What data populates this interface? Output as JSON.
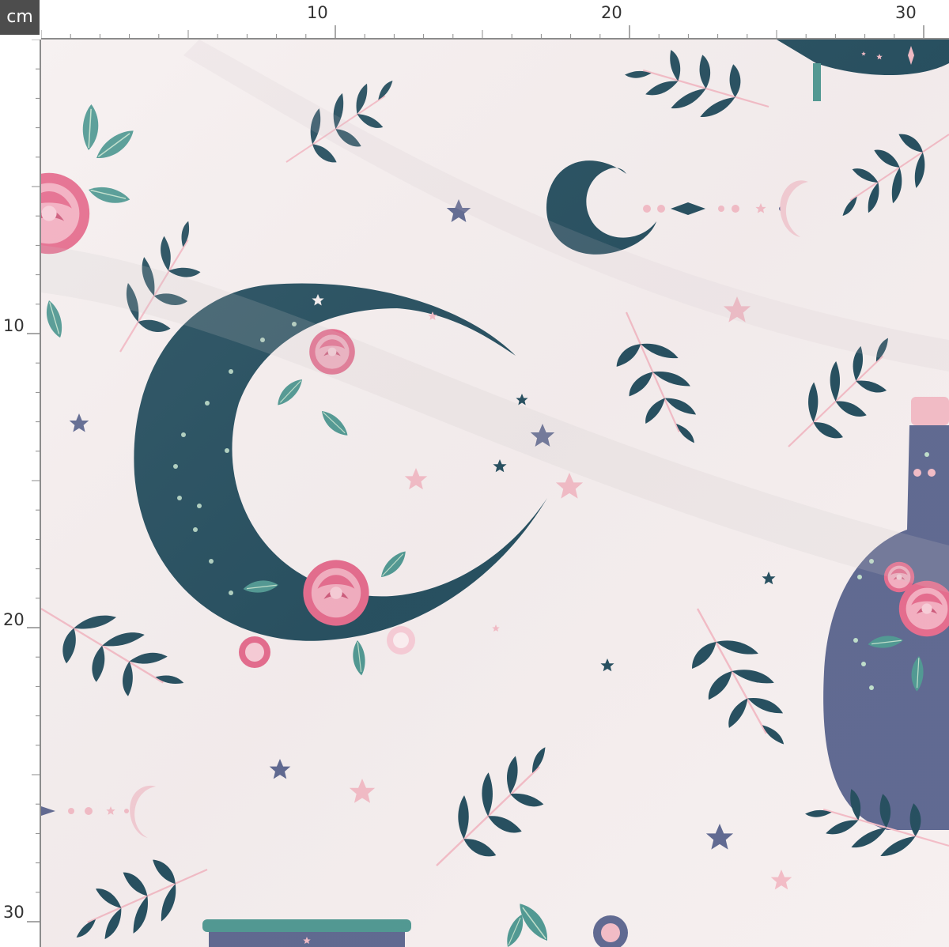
{
  "ruler": {
    "unit": "cm",
    "top_labels": [
      "10",
      "20",
      "30"
    ],
    "left_labels": [
      "10",
      "20",
      "30"
    ]
  },
  "colors": {
    "background": "#f5eeee",
    "navy": "#0f3d4f",
    "slate": "#4f5a86",
    "pink": "#f2b6c1",
    "rose": "#e35d82",
    "teal_leaf": "#3f8f88",
    "mint": "#b9dcc6"
  },
  "pattern": {
    "elements": [
      "crescent-moon-floral",
      "small-crescent-moon",
      "potion-bottle",
      "leaf-branch",
      "peony-flower",
      "star",
      "moon-phase-line",
      "cauldron"
    ]
  }
}
